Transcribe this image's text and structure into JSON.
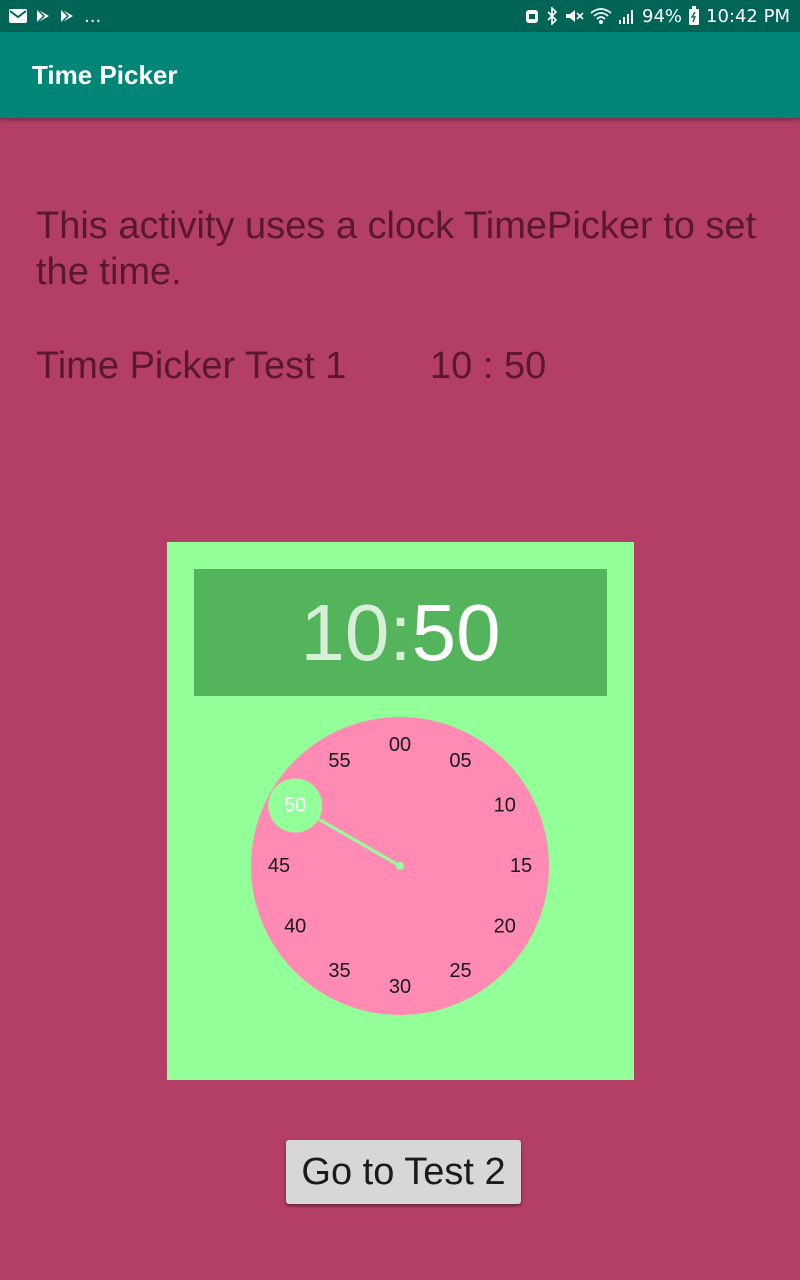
{
  "status_bar": {
    "overflow_dots": "...",
    "battery": "94%",
    "time": "10:42 PM"
  },
  "app_bar": {
    "title": "Time Picker"
  },
  "content": {
    "intro_text": "This activity uses a clock TimePicker to set the time.",
    "test_label": "Time Picker Test 1",
    "test_time": "10 : 50"
  },
  "time_picker": {
    "header_hour": "10",
    "header_separator": ":",
    "header_minute": "50",
    "selected_minute": "50",
    "minute_labels": [
      "00",
      "05",
      "10",
      "15",
      "20",
      "25",
      "30",
      "35",
      "40",
      "45",
      "50",
      "55"
    ],
    "colors": {
      "picker_bg": "#93ff99",
      "header_bg": "#54b45c",
      "dial_bg": "#ff8ab3",
      "selector": "#93ff99"
    }
  },
  "button": {
    "label": "Go to Test 2"
  },
  "icons": {
    "status_left": [
      "mail-icon",
      "play-store-icon",
      "play-store-icon"
    ],
    "status_right": [
      "alarm-icon",
      "bluetooth-icon",
      "mute-icon",
      "wifi-icon",
      "signal-icon",
      "battery-icon"
    ]
  },
  "colors": {
    "background": "#b33f66",
    "app_bar": "#008577",
    "status_bar": "#006456",
    "text": "#5b1630"
  }
}
